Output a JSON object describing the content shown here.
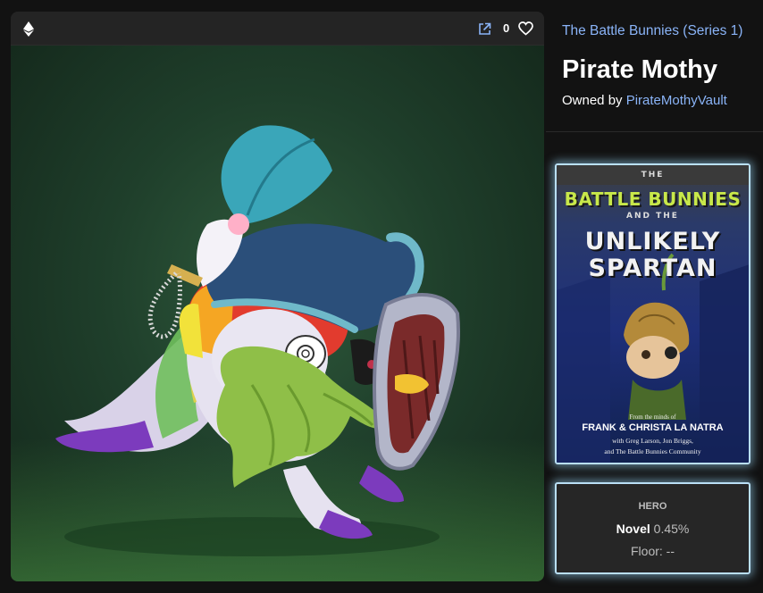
{
  "viewer": {
    "currency_icon": "ethereum-icon",
    "open_icon": "external-link-icon",
    "like_icon": "heart-icon",
    "like_count": "0"
  },
  "collection": {
    "name": "The Battle Bunnies (Series 1)"
  },
  "item": {
    "title": "Pirate Mothy",
    "owned_by_label": "Owned by",
    "owner": "PirateMothyVault"
  },
  "book": {
    "line1": "THE",
    "line2": "BATTLE BUNNIES",
    "line3": "AND THE",
    "line4": "UNLIKELY",
    "line5": "SPARTAN",
    "from": "From the minds of",
    "authors": "FRANK & CHRISTA LA NATRA",
    "with": "with Greg Larson, Jon Briggs,",
    "community": "and The Battle Bunnies Community"
  },
  "trait": {
    "type": "HERO",
    "value": "Novel",
    "percent": "0.45%",
    "floor": "Floor: --"
  }
}
